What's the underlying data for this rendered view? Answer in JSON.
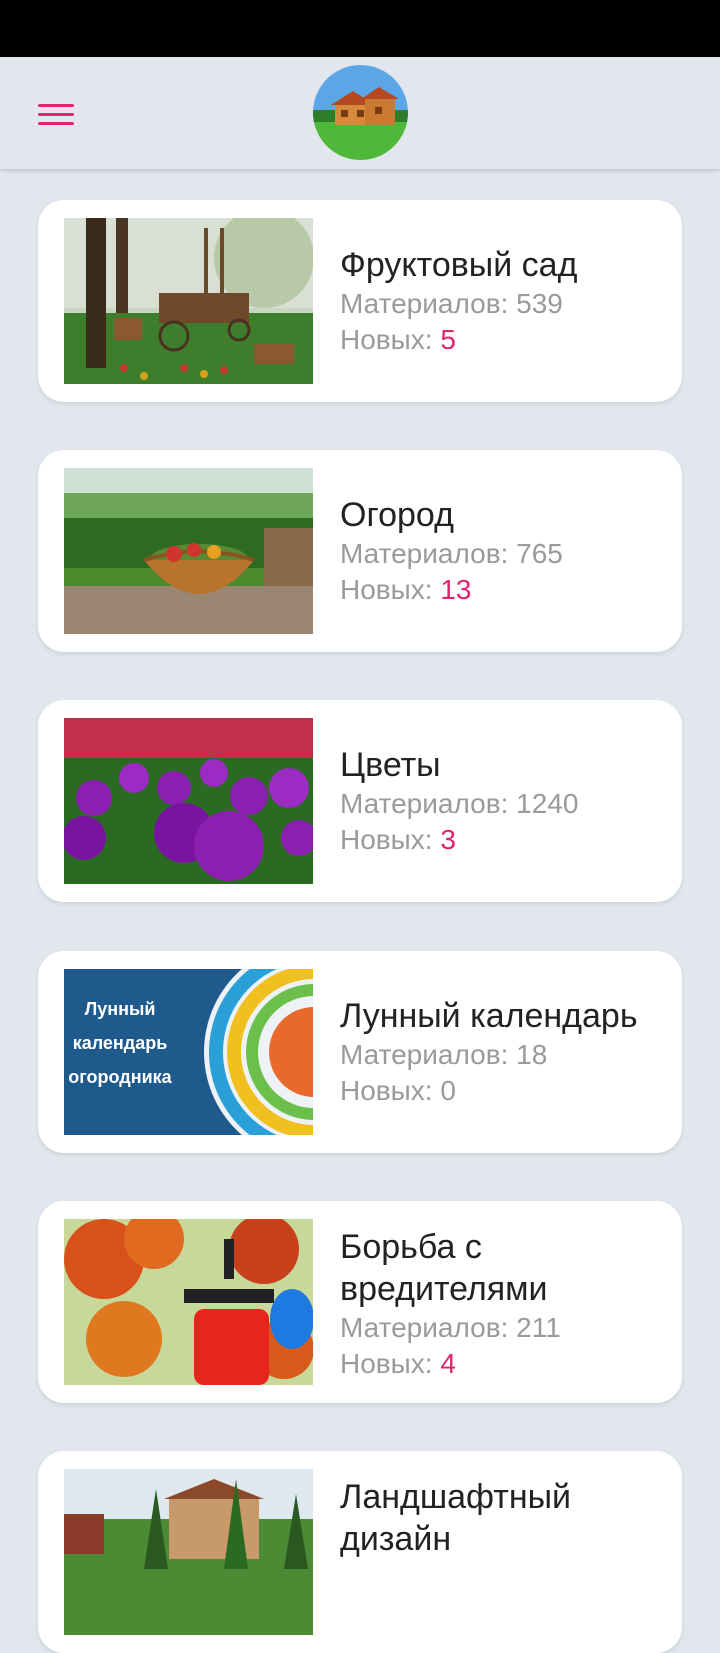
{
  "header": {
    "menu_icon": "hamburger-menu-icon",
    "logo_icon": "house-logo-icon"
  },
  "accent_color": "#e2246f",
  "categories": [
    {
      "title": "Фруктовый сад",
      "materials": "Материалов: 539",
      "new_label": "Новых: ",
      "new_count": "5",
      "image_icon": "orchard-image"
    },
    {
      "title": "Огород",
      "materials": "Материалов: 765",
      "new_label": "Новых: ",
      "new_count": "13",
      "image_icon": "vegetable-garden-image"
    },
    {
      "title": "Цветы",
      "materials": "Материалов: 1240",
      "new_label": "Новых: ",
      "new_count": "3",
      "image_icon": "flowers-image"
    },
    {
      "title": "Лунный календарь",
      "materials": "Материалов: 18",
      "new_label": "Новых: ",
      "new_count": "0",
      "image_icon": "lunar-calendar-image",
      "image_text": [
        "Лунный",
        "календарь",
        "огородника"
      ]
    },
    {
      "title": "Борьба с вредителями",
      "materials": "Материалов: 211",
      "new_label": "Новых: ",
      "new_count": "4",
      "image_icon": "pest-control-image"
    },
    {
      "title": "Ландшафтный дизайн",
      "image_icon": "landscape-design-image"
    }
  ]
}
